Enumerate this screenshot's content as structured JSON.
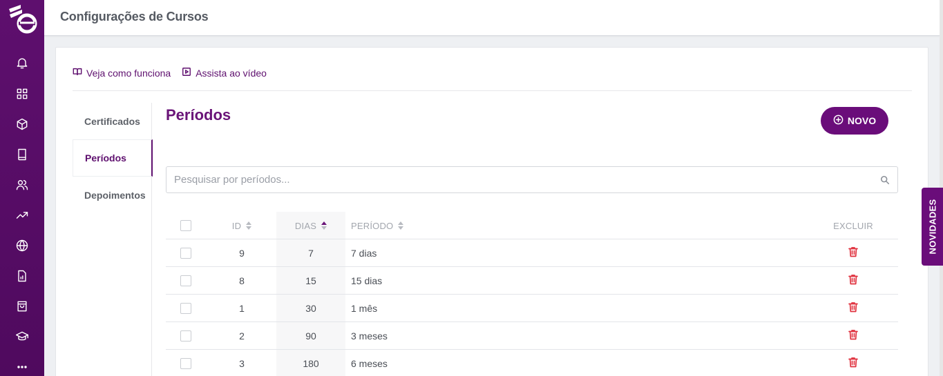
{
  "header": {
    "title": "Configurações de Cursos"
  },
  "help": {
    "how_it_works": "Veja como funciona",
    "watch_video": "Assista ao vídeo"
  },
  "tabs": [
    {
      "label": "Certificados",
      "active": false
    },
    {
      "label": "Períodos",
      "active": true
    },
    {
      "label": "Depoimentos",
      "active": false
    }
  ],
  "main": {
    "title": "Períodos",
    "new_button": "NOVO",
    "search_placeholder": "Pesquisar por períodos..."
  },
  "table": {
    "columns": {
      "id": "ID",
      "dias": "DIAS",
      "periodo": "PERÍODO",
      "excluir": "EXCLUIR"
    },
    "sorted_by": "DIAS",
    "sort_direction": "ascending",
    "rows": [
      {
        "id": "9",
        "dias": "7",
        "periodo": "7 dias"
      },
      {
        "id": "8",
        "dias": "15",
        "periodo": "15 dias"
      },
      {
        "id": "1",
        "dias": "30",
        "periodo": "1 mês"
      },
      {
        "id": "2",
        "dias": "90",
        "periodo": "3 meses"
      },
      {
        "id": "3",
        "dias": "180",
        "periodo": "6 meses"
      }
    ]
  },
  "novidades": "NOVIDADES",
  "sidebar": {
    "icons": [
      "bell-icon",
      "grid-icon",
      "box-icon",
      "book-icon",
      "users-icon",
      "trending-up-icon",
      "globe-icon",
      "report-icon",
      "shopping-bag-icon",
      "graduation-cap-icon",
      "more-icon"
    ]
  },
  "colors": {
    "brand": "#5e0f6e",
    "accent": "#6a0d7a",
    "danger": "#e0323f"
  }
}
